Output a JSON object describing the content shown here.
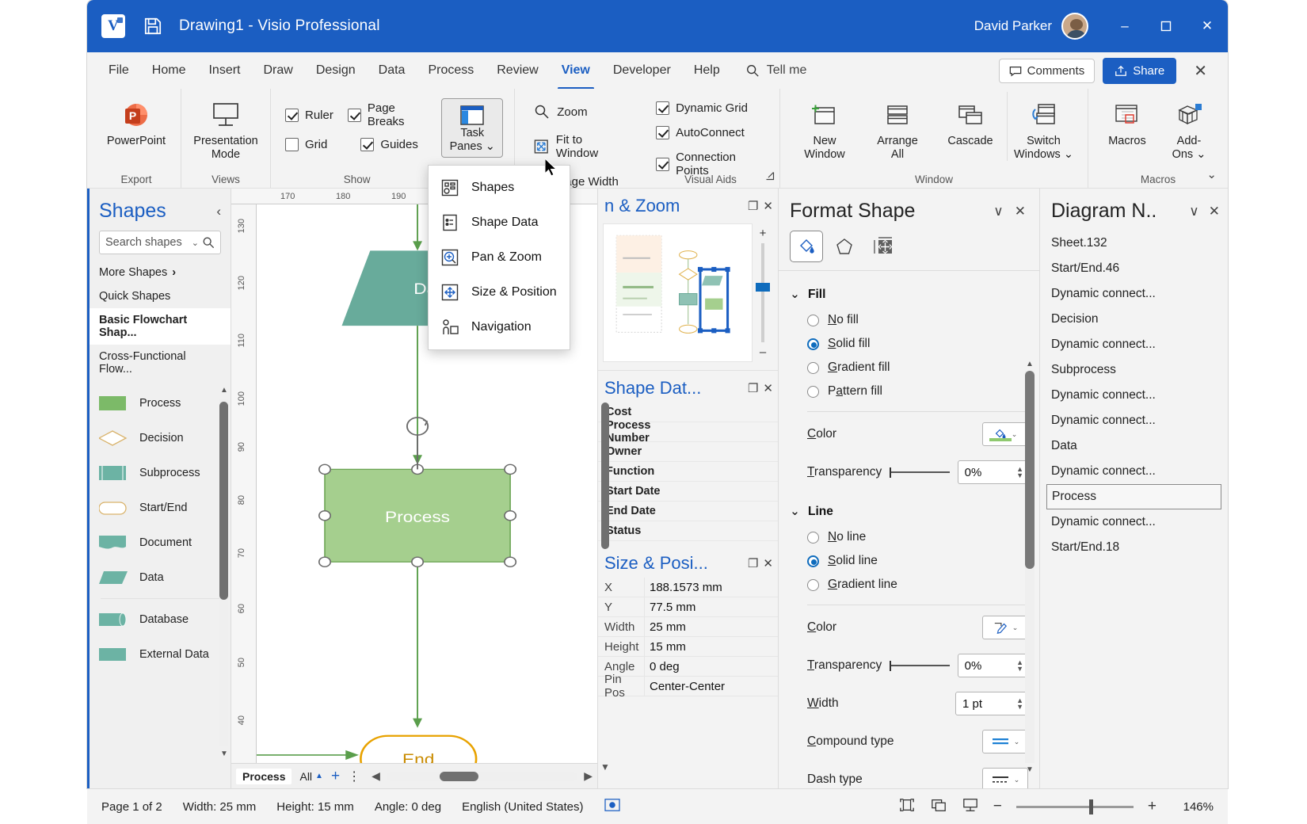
{
  "titlebar": {
    "app_icon": "visio-logo",
    "save_icon": "save-icon",
    "document_title": "Drawing1  -  Visio Professional",
    "user_name": "David Parker",
    "minimize": "–",
    "maximize": "❐",
    "close": "✕"
  },
  "ribbon_tabs": [
    {
      "label": "File",
      "active": false
    },
    {
      "label": "Home",
      "active": false
    },
    {
      "label": "Insert",
      "active": false
    },
    {
      "label": "Draw",
      "active": false
    },
    {
      "label": "Design",
      "active": false
    },
    {
      "label": "Data",
      "active": false
    },
    {
      "label": "Process",
      "active": false
    },
    {
      "label": "Review",
      "active": false
    },
    {
      "label": "View",
      "active": true
    },
    {
      "label": "Developer",
      "active": false
    },
    {
      "label": "Help",
      "active": false
    }
  ],
  "tellme": "Tell me",
  "comments_label": "Comments",
  "share_label": "Share",
  "ribbon": {
    "export": {
      "group_label": "Export",
      "powerpoint": "PowerPoint"
    },
    "views": {
      "group_label": "Views",
      "presentation_mode": "Presentation\nMode"
    },
    "show": {
      "group_label": "Show",
      "ruler": {
        "label": "Ruler",
        "checked": true
      },
      "page_breaks": {
        "label": "Page Breaks",
        "checked": true
      },
      "grid": {
        "label": "Grid",
        "checked": false
      },
      "guides": {
        "label": "Guides",
        "checked": true
      }
    },
    "task_panes": {
      "label": "Task\nPanes",
      "line1": "Task",
      "line2": "Panes"
    },
    "zoom_group": {
      "zoom": "Zoom",
      "fit_to_window": "Fit to Window",
      "page_width": "Page Width"
    },
    "visual_aids": {
      "group_label": "Visual Aids",
      "dynamic_grid": {
        "label": "Dynamic Grid",
        "checked": true
      },
      "autoconnect": {
        "label": "AutoConnect",
        "checked": true
      },
      "connection_points": {
        "label": "Connection Points",
        "checked": true
      }
    },
    "window": {
      "group_label": "Window",
      "new_window": "New\nWindow",
      "new_window_l1": "New",
      "new_window_l2": "Window",
      "arrange_all_l1": "Arrange",
      "arrange_all_l2": "All",
      "cascade": "Cascade",
      "switch_windows_l1": "Switch",
      "switch_windows_l2": "Windows"
    },
    "macros": {
      "group_label": "Macros",
      "macros": "Macros",
      "addons_l1": "Add-",
      "addons_l2": "Ons"
    }
  },
  "task_panes_menu": [
    {
      "label": "Shapes",
      "icon": "shapes-icon"
    },
    {
      "label": "Shape Data",
      "icon": "shape-data-icon"
    },
    {
      "label": "Pan & Zoom",
      "icon": "pan-zoom-icon"
    },
    {
      "label": "Size & Position",
      "icon": "size-position-icon"
    },
    {
      "label": "Navigation",
      "icon": "navigation-icon"
    }
  ],
  "shapes_pane": {
    "title": "Shapes",
    "collapse_icon": "chevron-left-icon",
    "search_placeholder": "Search shapes",
    "stencils": [
      {
        "label": "More Shapes",
        "selected": false,
        "has_arrow": true
      },
      {
        "label": "Quick Shapes",
        "selected": false,
        "has_arrow": false
      },
      {
        "label": "Basic Flowchart Shap...",
        "selected": true,
        "has_arrow": false
      },
      {
        "label": "Cross-Functional Flow...",
        "selected": false,
        "has_arrow": false
      }
    ],
    "shapes": [
      {
        "label": "Process",
        "color": "#7cba68",
        "kind": "rect"
      },
      {
        "label": "Decision",
        "color": "#ffffff",
        "kind": "diamond"
      },
      {
        "label": "Subprocess",
        "color": "#6cb3a4",
        "kind": "subprocess"
      },
      {
        "label": "Start/End",
        "color": "#ffffff",
        "kind": "pill"
      },
      {
        "label": "Document",
        "color": "#6cb3a4",
        "kind": "document"
      },
      {
        "label": "Data",
        "color": "#6cb3a4",
        "kind": "parallelogram"
      },
      {
        "label": "Database",
        "color": "#6cb3a4",
        "kind": "database"
      },
      {
        "label": "External Data",
        "color": "#6cb3a4",
        "kind": "extdata"
      }
    ]
  },
  "canvas": {
    "ruler_h_ticks": [
      "170",
      "180",
      "190"
    ],
    "ruler_v_ticks": [
      "130",
      "120",
      "110",
      "100",
      "90",
      "80",
      "70",
      "60",
      "50",
      "40"
    ],
    "shapes": [
      {
        "name": "Data",
        "label": "Data",
        "type": "parallelogram",
        "fill": "#68ab9b"
      },
      {
        "name": "Process",
        "label": "Process",
        "type": "rectangle",
        "fill": "#a5cf8e",
        "selected": true
      },
      {
        "name": "End",
        "label": "End",
        "type": "terminator",
        "fill": "#ffffff",
        "stroke": "#e8a200"
      }
    ]
  },
  "page_tabs": {
    "current": "Process",
    "all_label": "All",
    "add_icon": "plus-icon",
    "more_icon": "more-vertical-icon"
  },
  "pan_zoom": {
    "title": "n & Zoom",
    "full_title": "Pan & Zoom",
    "restore": "❐",
    "close": "✕",
    "plus": "+",
    "minus": "–"
  },
  "shape_data": {
    "title": "Shape Dat...",
    "full_title": "Shape Data",
    "rows": [
      {
        "key": "Cost",
        "value": ""
      },
      {
        "key": "Process Number",
        "value": ""
      },
      {
        "key": "Owner",
        "value": ""
      },
      {
        "key": "Function",
        "value": ""
      },
      {
        "key": "Start Date",
        "value": ""
      },
      {
        "key": "End Date",
        "value": ""
      },
      {
        "key": "Status",
        "value": ""
      }
    ]
  },
  "size_position": {
    "title": "Size & Posi...",
    "full_title": "Size & Position",
    "rows": [
      {
        "key": "X",
        "value": "188.1573 mm"
      },
      {
        "key": "Y",
        "value": "77.5 mm"
      },
      {
        "key": "Width",
        "value": "25 mm"
      },
      {
        "key": "Height",
        "value": "15 mm"
      },
      {
        "key": "Angle",
        "value": "0 deg"
      },
      {
        "key": "Pin Pos",
        "value": "Center-Center"
      }
    ]
  },
  "format_shape": {
    "title": "Format Shape",
    "collapse": "∨",
    "close": "✕",
    "tabs": [
      {
        "name": "fill-line-tab",
        "icon": "paint-bucket-icon",
        "active": true
      },
      {
        "name": "effects-tab",
        "icon": "pentagon-icon",
        "active": false
      },
      {
        "name": "size-properties-tab",
        "icon": "size-icon",
        "active": false
      }
    ],
    "fill": {
      "group_label": "Fill",
      "options": [
        {
          "label": "No fill",
          "accel": "N",
          "selected": false
        },
        {
          "label": "Solid fill",
          "accel": "S",
          "selected": true
        },
        {
          "label": "Gradient fill",
          "accel": "G",
          "selected": false
        },
        {
          "label": "Pattern fill",
          "accel": "P",
          "selected": false
        }
      ],
      "color_label": "Color",
      "color_value": "#8fc96f",
      "transparency_label": "Transparency",
      "transparency_value": "0%"
    },
    "line": {
      "group_label": "Line",
      "options": [
        {
          "label": "No line",
          "accel": "N",
          "selected": false
        },
        {
          "label": "Solid line",
          "accel": "S",
          "selected": true
        },
        {
          "label": "Gradient line",
          "accel": "G",
          "selected": false
        }
      ],
      "color_label": "Color",
      "transparency_label": "Transparency",
      "transparency_value": "0%",
      "width_label": "Width",
      "width_value": "1 pt",
      "compound_label": "Compound type",
      "dash_label": "Dash type"
    }
  },
  "diagram_navigator": {
    "title": "Diagram N..",
    "full_title": "Diagram Navigator",
    "dropdown": "∨",
    "close": "✕",
    "items": [
      {
        "label": "Sheet.132",
        "selected": false
      },
      {
        "label": "Start/End.46",
        "selected": false
      },
      {
        "label": "Dynamic connect...",
        "selected": false
      },
      {
        "label": "Decision",
        "selected": false
      },
      {
        "label": "Dynamic connect...",
        "selected": false
      },
      {
        "label": "Subprocess",
        "selected": false
      },
      {
        "label": "Dynamic connect...",
        "selected": false
      },
      {
        "label": "Dynamic connect...",
        "selected": false
      },
      {
        "label": "Data",
        "selected": false
      },
      {
        "label": "Dynamic connect...",
        "selected": false
      },
      {
        "label": "Process",
        "selected": true
      },
      {
        "label": "Dynamic connect...",
        "selected": false
      },
      {
        "label": "Start/End.18",
        "selected": false
      }
    ]
  },
  "statusbar": {
    "page": "Page 1 of 2",
    "width": "Width: 25 mm",
    "height": "Height: 15 mm",
    "angle": "Angle: 0 deg",
    "language": "English (United States)",
    "macro_icon": "macro-record-icon",
    "zoom_out": "−",
    "zoom_in": "+",
    "zoom_level": "146%",
    "view_icons": [
      "fit-page-icon",
      "full-screen-icon",
      "presentation-icon"
    ]
  }
}
